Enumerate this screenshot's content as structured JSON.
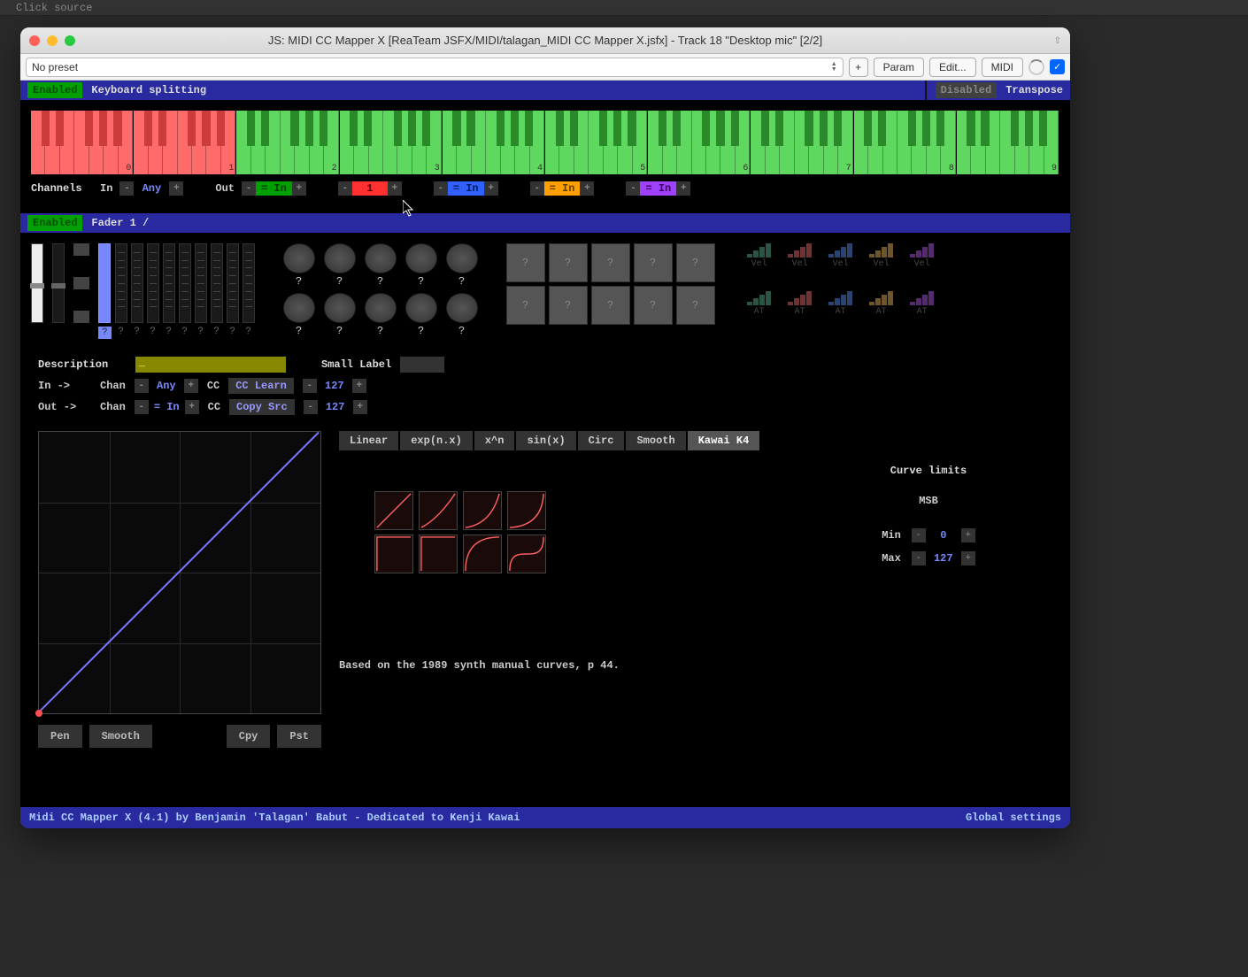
{
  "bg_bar": "Click source",
  "window": {
    "title": "JS: MIDI CC Mapper X [ReaTeam JSFX/MIDI/talagan_MIDI CC Mapper X.jsfx] - Track 18 \"Desktop mic\" [2/2]"
  },
  "toolbar": {
    "preset": "No preset",
    "plus": "+",
    "param": "Param",
    "edit": "Edit...",
    "midi": "MIDI"
  },
  "sections": {
    "kb": {
      "enabled": "Enabled",
      "label": "Keyboard splitting",
      "transpose_dis": "Disabled",
      "transpose_lab": "Transpose"
    },
    "fader": {
      "enabled": "Enabled",
      "label": "Fader 1 /"
    }
  },
  "channels": {
    "label": "Channels",
    "in_lab": "In",
    "in_val": "Any",
    "out_lab": "Out",
    "out1": "= In",
    "out2": "1",
    "out3": "= In",
    "out4": "= In",
    "out5": "= In"
  },
  "octaves": [
    "0",
    "1",
    "2",
    "3",
    "4",
    "5",
    "6",
    "7",
    "8",
    "9"
  ],
  "vel_labels": [
    "Vel",
    "Vel",
    "Vel",
    "Vel",
    "Vel",
    "AT",
    "AT",
    "AT",
    "AT",
    "AT"
  ],
  "params": {
    "desc_lab": "Description",
    "small_lab": "Small Label",
    "in_lab": "In  ->",
    "out_lab": "Out ->",
    "chan_lab": "Chan",
    "cc_lab": "CC",
    "in_chan": "Any",
    "in_cc_box": "CC Learn",
    "in_cc_val": "127",
    "out_chan": "= In",
    "out_cc_box": "Copy Src",
    "out_cc_val": "127"
  },
  "curve": {
    "tabs": [
      "Linear",
      "exp(n.x)",
      "x^n",
      "sin(x)",
      "Circ",
      "Smooth",
      "Kawai K4"
    ],
    "active_tab": 6,
    "note": "Based on the 1989 synth manual curves, p 44.",
    "limits_title": "Curve limits",
    "msb": "MSB",
    "min_lab": "Min",
    "min_val": "0",
    "max_lab": "Max",
    "max_val": "127",
    "tools": {
      "pen": "Pen",
      "smooth": "Smooth",
      "cpy": "Cpy",
      "pst": "Pst"
    }
  },
  "footer": {
    "left": "Midi CC Mapper X (4.1) by Benjamin 'Talagan' Babut - Dedicated to Kenji Kawai",
    "right": "Global settings"
  },
  "q": "?",
  "minus": "-",
  "plus": "+"
}
